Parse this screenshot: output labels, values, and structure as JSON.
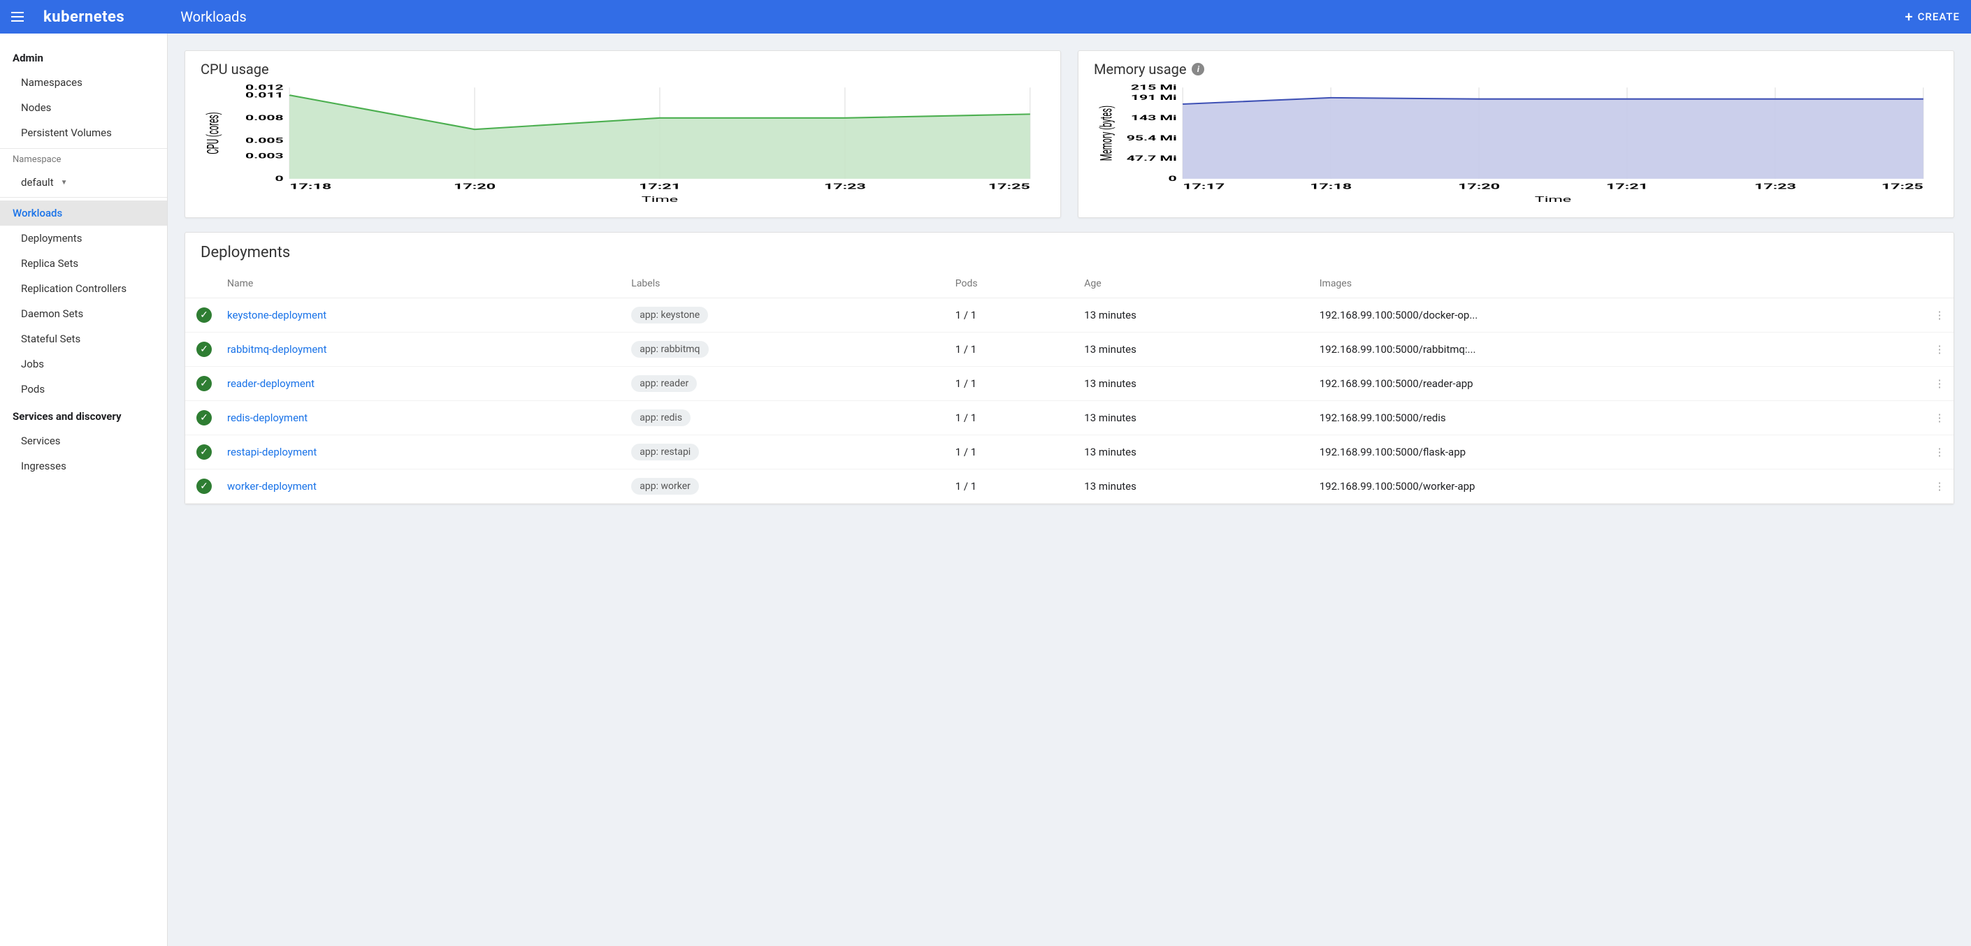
{
  "topbar": {
    "brand": "kubernetes",
    "page_title": "Workloads",
    "create_label": "CREATE"
  },
  "sidebar": {
    "admin_label": "Admin",
    "admin_items": [
      "Namespaces",
      "Nodes",
      "Persistent Volumes"
    ],
    "namespace_label": "Namespace",
    "namespace_selected": "default",
    "workloads_label": "Workloads",
    "workload_items": [
      "Deployments",
      "Replica Sets",
      "Replication Controllers",
      "Daemon Sets",
      "Stateful Sets",
      "Jobs",
      "Pods"
    ],
    "services_label": "Services and discovery",
    "services_items": [
      "Services",
      "Ingresses"
    ]
  },
  "cpu_card": {
    "title": "CPU usage"
  },
  "mem_card": {
    "title": "Memory usage"
  },
  "chart_data": [
    {
      "type": "area",
      "title": "CPU usage",
      "xlabel": "Time",
      "ylabel": "CPU (cores)",
      "color_line": "#4caf50",
      "color_fill": "#c8e6c9",
      "x": [
        "17:18",
        "17:20",
        "17:21",
        "17:23",
        "17:25"
      ],
      "values": [
        0.011,
        0.0065,
        0.008,
        0.008,
        0.0085
      ],
      "yticks": [
        0,
        0.003,
        0.005,
        0.008,
        0.011,
        0.012
      ],
      "ylim": [
        0,
        0.012
      ]
    },
    {
      "type": "area",
      "title": "Memory usage",
      "xlabel": "Time",
      "ylabel": "Memory (bytes)",
      "color_line": "#3f51b5",
      "color_fill": "#c5cae9",
      "x": [
        "17:17",
        "17:18",
        "17:20",
        "17:21",
        "17:23",
        "17:25"
      ],
      "values": [
        176,
        191,
        188,
        188,
        188,
        188
      ],
      "yticks": [
        0,
        47.7,
        95.4,
        143,
        191,
        215
      ],
      "ytick_labels": [
        "0",
        "47.7 Mi",
        "95.4 Mi",
        "143 Mi",
        "191 Mi",
        "215 Mi"
      ],
      "ylim": [
        0,
        215
      ]
    }
  ],
  "deployments": {
    "title": "Deployments",
    "columns": [
      "Name",
      "Labels",
      "Pods",
      "Age",
      "Images"
    ],
    "rows": [
      {
        "name": "keystone-deployment",
        "label": "app: keystone",
        "pods": "1 / 1",
        "age": "13 minutes",
        "image": "192.168.99.100:5000/docker-op..."
      },
      {
        "name": "rabbitmq-deployment",
        "label": "app: rabbitmq",
        "pods": "1 / 1",
        "age": "13 minutes",
        "image": "192.168.99.100:5000/rabbitmq:..."
      },
      {
        "name": "reader-deployment",
        "label": "app: reader",
        "pods": "1 / 1",
        "age": "13 minutes",
        "image": "192.168.99.100:5000/reader-app"
      },
      {
        "name": "redis-deployment",
        "label": "app: redis",
        "pods": "1 / 1",
        "age": "13 minutes",
        "image": "192.168.99.100:5000/redis"
      },
      {
        "name": "restapi-deployment",
        "label": "app: restapi",
        "pods": "1 / 1",
        "age": "13 minutes",
        "image": "192.168.99.100:5000/flask-app"
      },
      {
        "name": "worker-deployment",
        "label": "app: worker",
        "pods": "1 / 1",
        "age": "13 minutes",
        "image": "192.168.99.100:5000/worker-app"
      }
    ]
  }
}
